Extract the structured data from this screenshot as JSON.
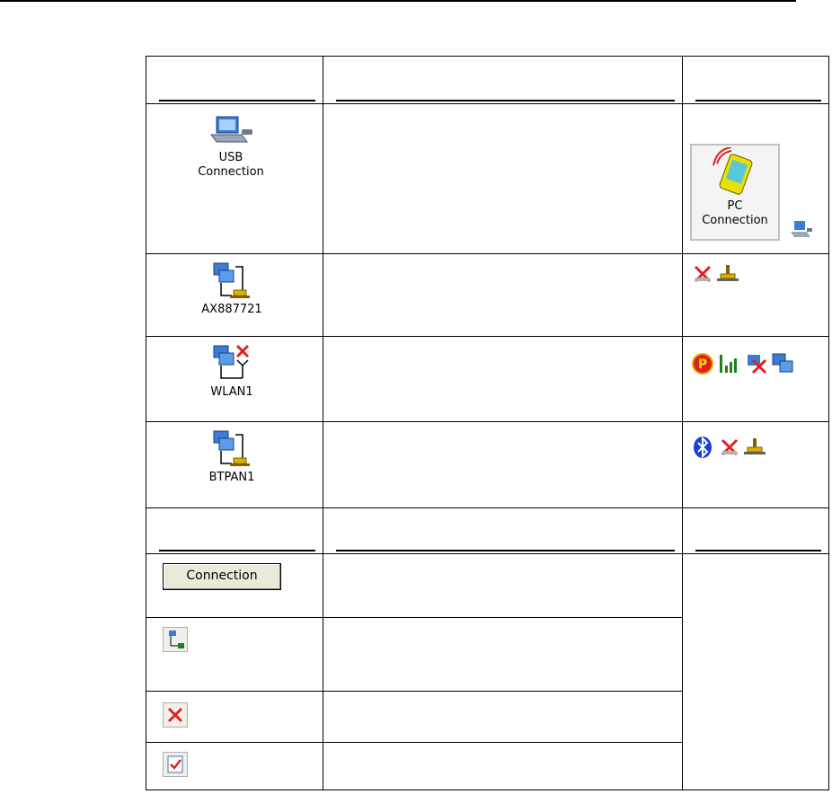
{
  "rows": {
    "usb": {
      "label_line1": "USB",
      "label_line2": "Connection",
      "status_label_line1": "PC",
      "status_label_line2": "Connection"
    },
    "ax": {
      "label": "AX887721"
    },
    "wlan": {
      "label": "WLAN1"
    },
    "btpan": {
      "label": "BTPAN1"
    }
  },
  "toolbar": {
    "connection_button_label": "Connection"
  },
  "icons": {
    "usb": "laptop-connection-icon",
    "ax": "lan-adapter-icon",
    "wlan": "wlan-adapter-icon",
    "btpan": "bluetooth-pan-adapter-icon",
    "pc_connection": "pda-sync-icon",
    "properties": "network-properties-icon",
    "delete": "red-x-icon",
    "check": "checklist-icon"
  },
  "colors": {
    "border": "#000000",
    "button_bg": "#ece9d8",
    "delete_red": "#e02020",
    "bluetooth_blue": "#1a3fd6",
    "monitor_blue": "#3a7bd5",
    "cable_yellow": "#e0b000"
  }
}
